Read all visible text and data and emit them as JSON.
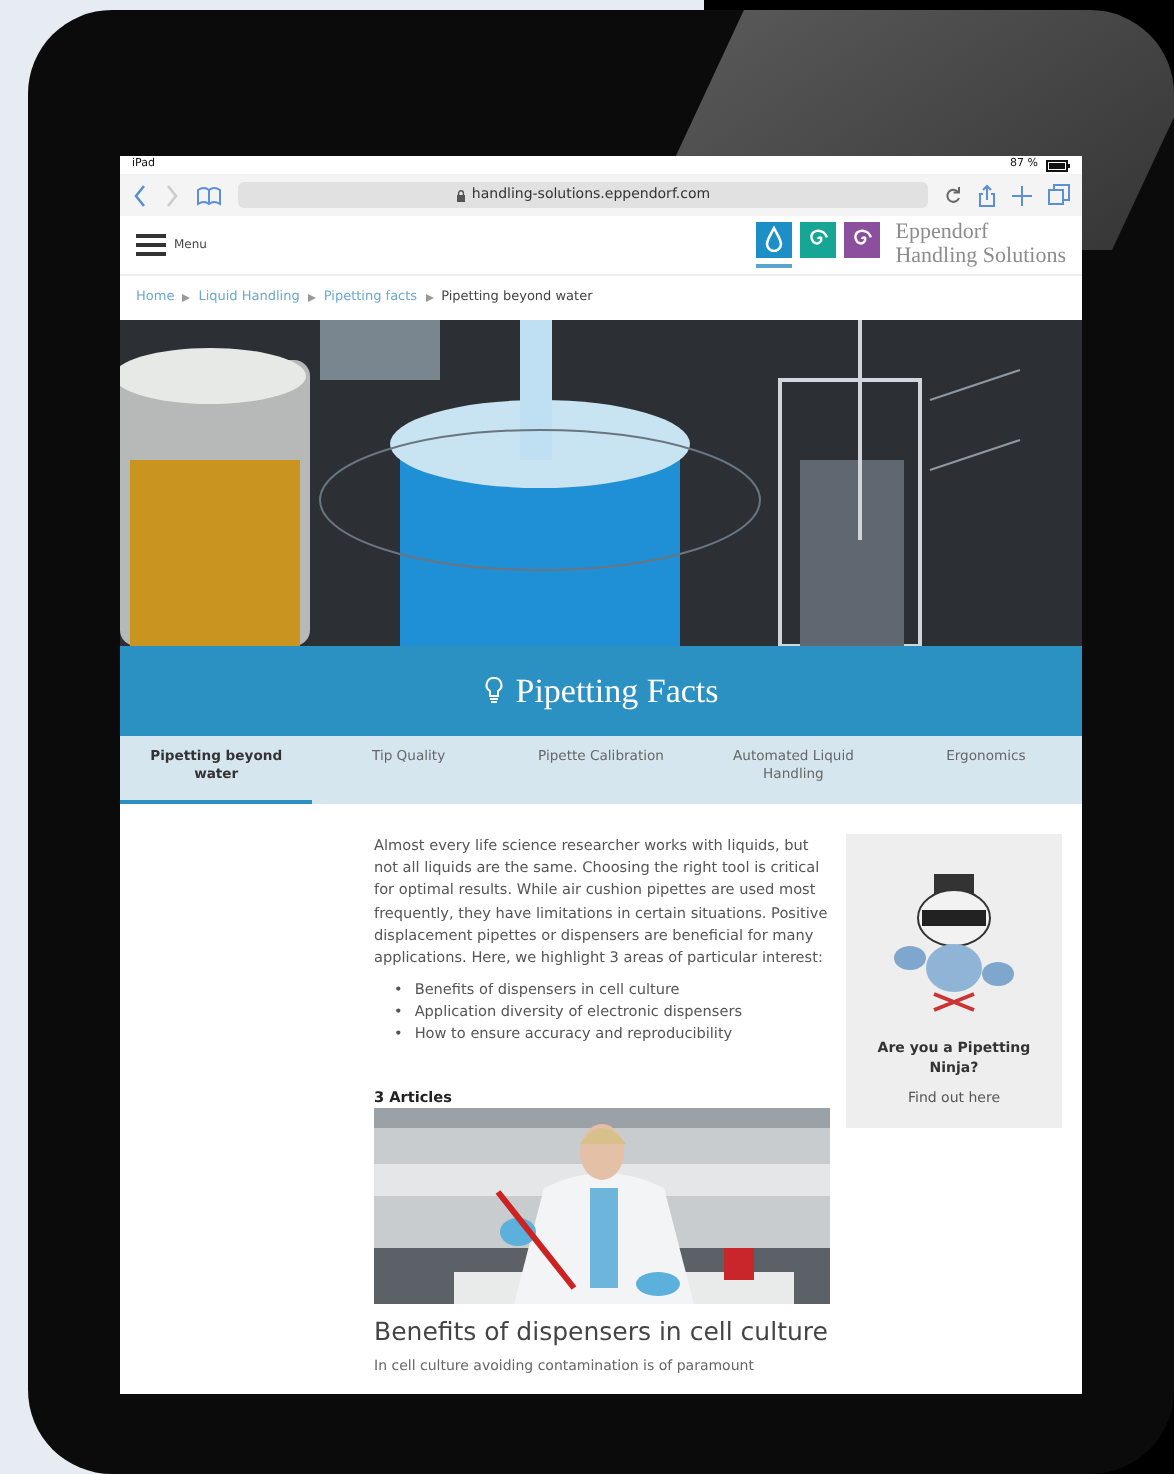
{
  "status_bar": {
    "device": "iPad",
    "battery": "87 %"
  },
  "browser": {
    "url": "handling-solutions.eppendorf.com"
  },
  "header": {
    "menu_label": "Menu",
    "brand_line_1": "Eppendorf",
    "brand_line_2": "Handling Solutions",
    "logos": [
      {
        "kind": "drop",
        "color": "#1b8fc6",
        "selected": true
      },
      {
        "kind": "spiral",
        "color": "#17a595",
        "selected": false
      },
      {
        "kind": "spiral",
        "color": "#8b4f9e",
        "selected": false
      }
    ]
  },
  "breadcrumb": [
    {
      "label": "Home",
      "current": false
    },
    {
      "label": "Liquid Handling",
      "current": false
    },
    {
      "label": "Pipetting facts",
      "current": false
    },
    {
      "label": "Pipetting beyond water",
      "current": true
    }
  ],
  "hero": {
    "kind": "picture",
    "title": "Pipetting Facts"
  },
  "tabs": [
    {
      "label": "Pipetting beyond water",
      "selected": true
    },
    {
      "label": "Tip Quality",
      "selected": false
    },
    {
      "label": "Pipette Calibration",
      "selected": false
    },
    {
      "label": "Automated Liquid Handling",
      "selected": false
    },
    {
      "label": "Ergonomics",
      "selected": false
    }
  ],
  "intro": {
    "text": "Almost every life science researcher works with liquids, but not all liquids are the same. Choosing the right tool is critical for optimal results. While air cushion pipettes are used most frequently, they have limitations in certain situations. Positive displacement pipettes or dispensers are beneficial for many applications. Here, we highlight 3 areas of particular interest:",
    "bullets": [
      {
        "marker": "•",
        "text": "Benefits of dispensers in cell culture"
      },
      {
        "marker": "•",
        "text": "Application diversity of electronic dispensers"
      },
      {
        "marker": "•",
        "text": "How to ensure accuracy and reproducibility"
      }
    ]
  },
  "promo": {
    "kind": "picture",
    "title": "Are you a Pipetting Ninja?",
    "link": "Find out here"
  },
  "articles": {
    "count_label": "3 Articles",
    "items": [
      {
        "kind": "picture",
        "title": "Benefits of dispensers in cell culture",
        "excerpt": "In cell culture avoiding contamination is of paramount"
      }
    ]
  }
}
